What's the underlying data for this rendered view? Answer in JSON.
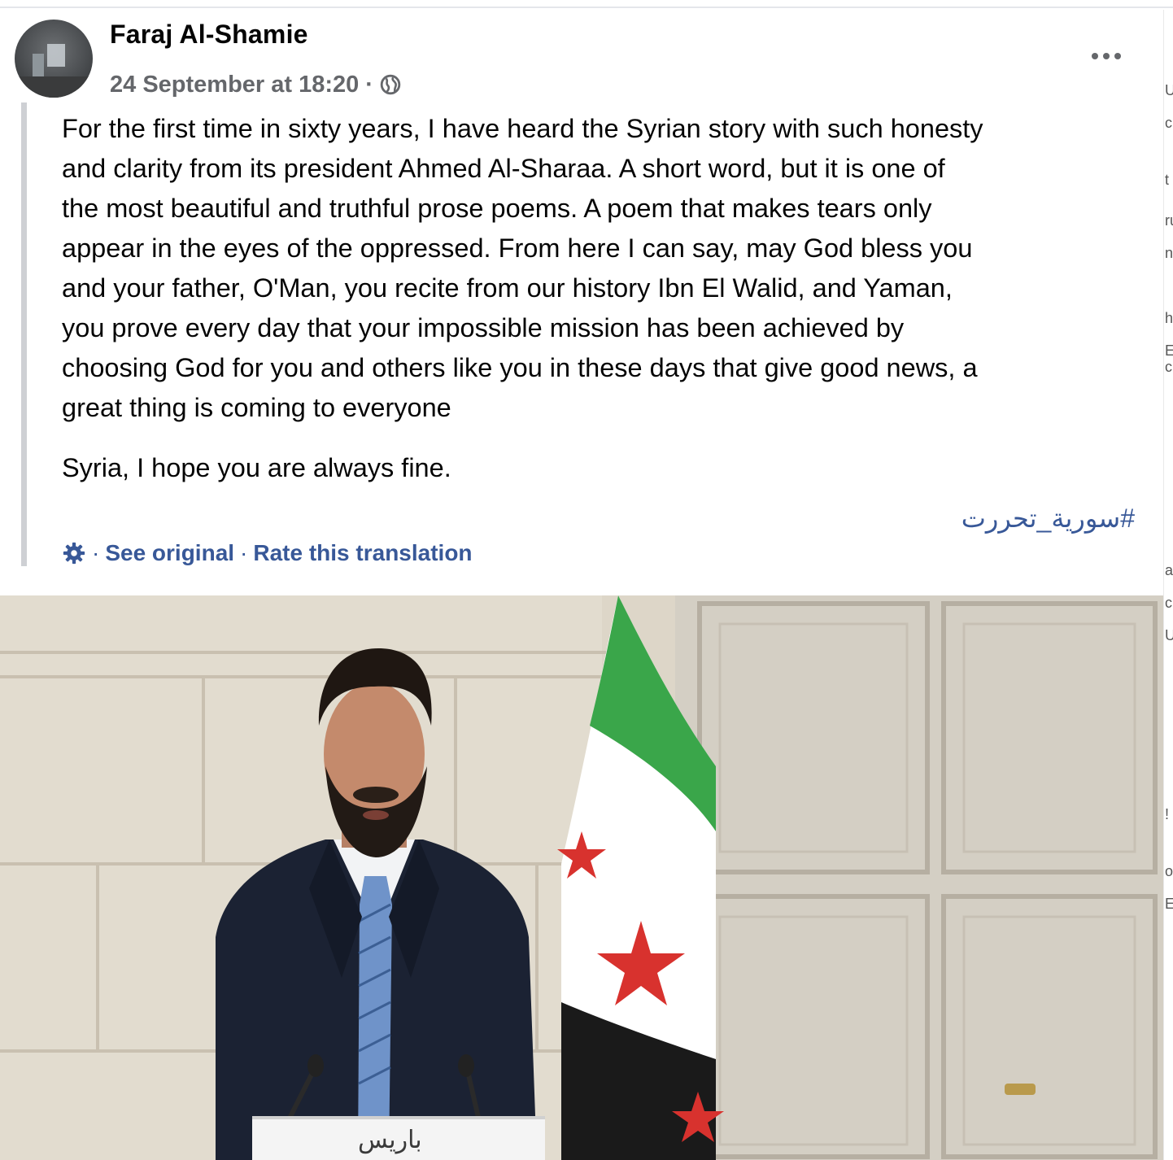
{
  "post": {
    "author_name": "Faraj Al-Shamie",
    "timestamp": "24 September at 18:20",
    "meta_separator": "·",
    "privacy_icon": "globe-icon",
    "more_icon": "more-options-icon",
    "text_lines": [
      "For the first time in sixty years, I have heard the Syrian story with such honesty",
      "and clarity from its president Ahmed Al-Sharaa. A short word, but it is one of",
      "the most beautiful and truthful prose poems. A poem that makes tears only",
      "appear in the eyes of the oppressed. From here I can say, may God bless you",
      "and your father, O'Man, you recite from our history Ibn El Walid, and Yaman,",
      "you prove every day that your impossible mission has been achieved by",
      "choosing God for you and others like you in these days that give good news, a",
      "great thing is coming to everyone"
    ],
    "closing_line": "Syria, I hope you are always fine.",
    "hashtag": "#سورية_تحررت",
    "translation": {
      "icon": "gear-icon",
      "separator": "·",
      "see_original": "See original",
      "rate_translation": "Rate this translation"
    },
    "photo": {
      "podium_label": "باريس"
    }
  },
  "colors": {
    "author": "#050505",
    "meta": "#65676b",
    "link": "#385898",
    "quote_bar": "#ced0d4",
    "flag_green": "#3aa64a",
    "flag_white": "#ffffff",
    "flag_black": "#1a1a1a",
    "flag_star": "#d8322e"
  }
}
